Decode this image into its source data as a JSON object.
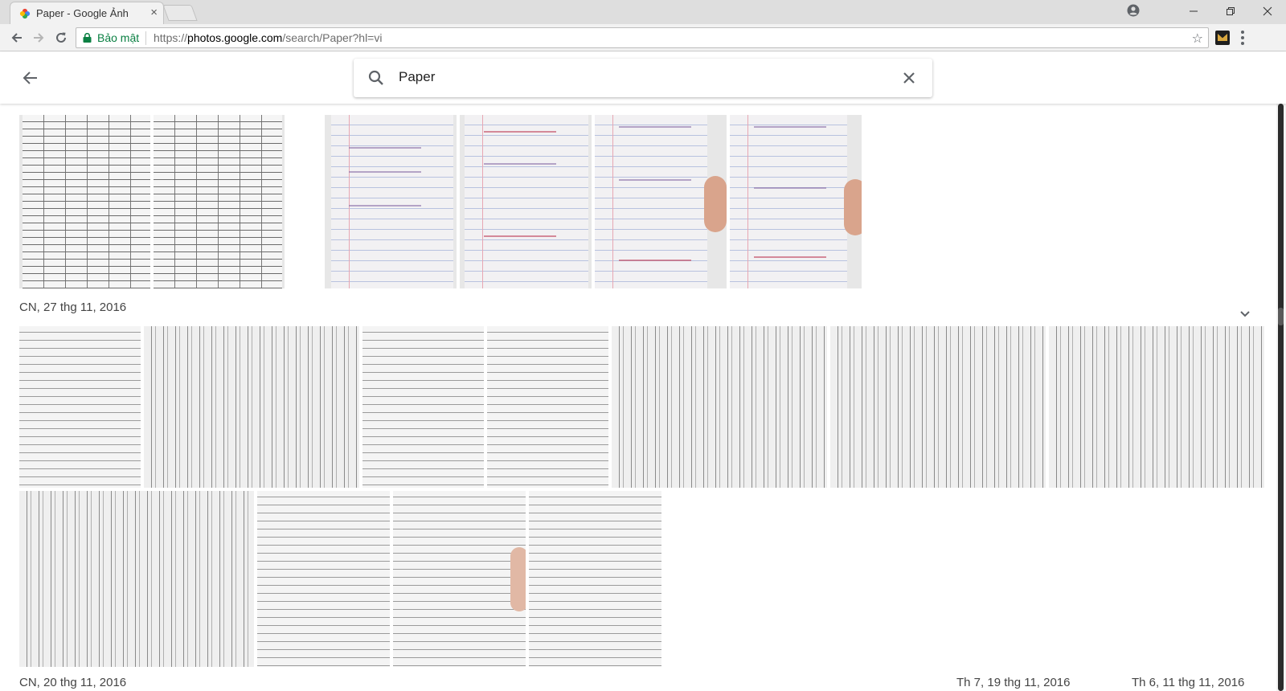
{
  "browser": {
    "tab_title": "Paper - Google Ảnh",
    "tab_close": "×",
    "secure_label": "Bảo mật",
    "url_scheme": "https://",
    "url_host": "photos.google.com",
    "url_path": "/search/Paper?hl=vi",
    "star": "☆"
  },
  "search": {
    "query": "Paper"
  },
  "sections": [
    {
      "date": "CN, 27 thg 11, 2016"
    },
    {
      "date": "CN, 20 thg 11, 2016"
    },
    {
      "date": "Th 7, 19 thg 11, 2016"
    },
    {
      "date": "Th 6, 11 thg 11, 2016"
    }
  ],
  "colors": {
    "secure_green": "#0b8043",
    "scrollbar_thumb": "#2b2b2b"
  },
  "icons": {
    "back": "arrow-back-icon",
    "search": "search-icon",
    "clear": "close-icon",
    "expand": "chevron-down-icon"
  }
}
